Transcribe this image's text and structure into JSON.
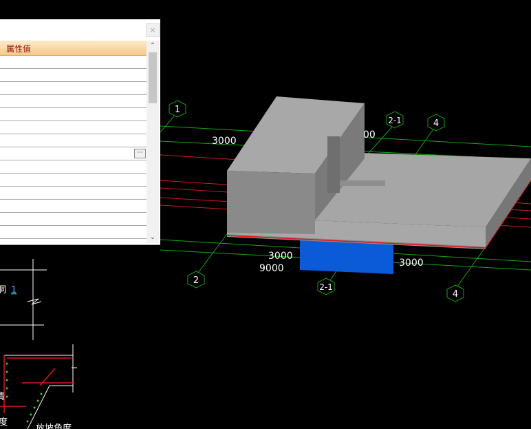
{
  "panel": {
    "header_label": "属性值",
    "close_glyph": "×",
    "ellipsis_label": "···",
    "scroll_up_glyph": "⌃",
    "scroll_down_glyph": "⌄",
    "row_count": 14
  },
  "viewport": {
    "axis_bubbles": [
      "1",
      "2-1",
      "4",
      "2",
      "2-1",
      "4"
    ],
    "dim_labels": [
      "3000",
      "00",
      "3000",
      "9000",
      "3000"
    ],
    "colors": {
      "background": "#000000",
      "grid_green": "#12a612",
      "grid_red": "#d21a1a",
      "solid": "#a7a7a7",
      "column_blue": "#0b5ad8"
    }
  },
  "preview": {
    "label_1_char": "洞",
    "label_1_link": "1",
    "label_2_char": "度",
    "label_3_char": "清",
    "label_4": "放坡角度"
  }
}
